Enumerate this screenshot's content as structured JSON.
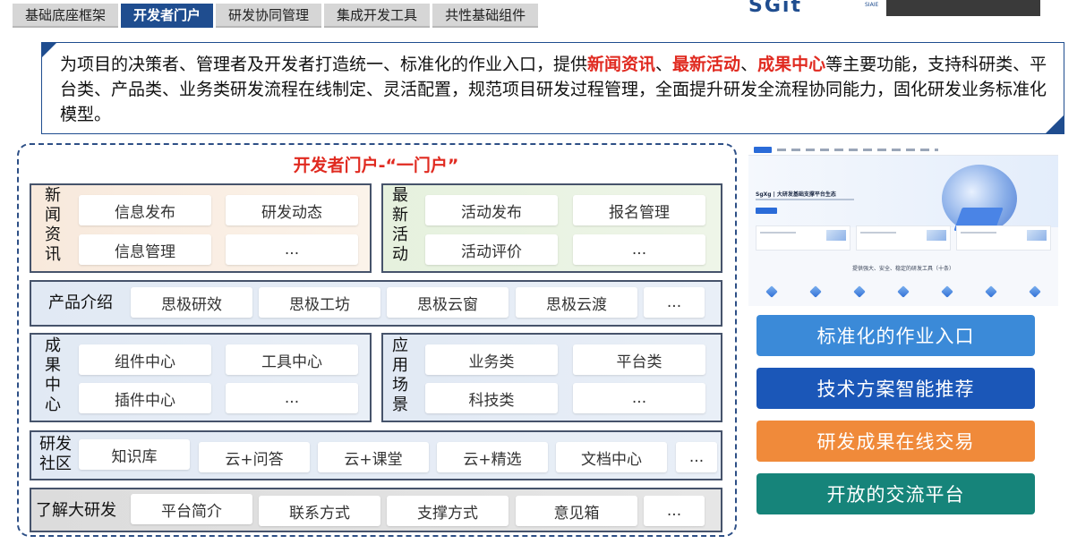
{
  "tabs": [
    "基础底座框架",
    "开发者门户",
    "研发协同管理",
    "集成开发工具",
    "共性基础组件"
  ],
  "active_tab": "开发者门户",
  "logo": {
    "text": "SGit",
    "sub": "SIAIE"
  },
  "intro": {
    "part1": "为项目的决策者、管理者及开发者打造统一、标准化的作业入口，提供",
    "hl1": "新闻资讯",
    "sep1": "、",
    "hl2": "最新活动",
    "sep2": "、",
    "hl3": "成果中心",
    "part2": "等主要功能，支持科研类、平台类、产品类、业务类研发流程在线制定、灵活配置，规范项目研发过程管理，全面提升研发全流程协同能力，固化研发业务标准化模型。"
  },
  "portal": {
    "title": "开发者门户-“一门户”",
    "news": {
      "label": "新闻资讯",
      "items": [
        "信息发布",
        "研发动态",
        "信息管理",
        "..."
      ]
    },
    "activities": {
      "label": "最新活动",
      "items": [
        "活动发布",
        "报名管理",
        "活动评价",
        "..."
      ]
    },
    "products": {
      "label": "产品介绍",
      "items": [
        "思极研效",
        "思极工坊",
        "思极云窗",
        "思极云渡",
        "..."
      ]
    },
    "results": {
      "label": "成果中心",
      "items": [
        "组件中心",
        "工具中心",
        "插件中心",
        "..."
      ]
    },
    "scenarios": {
      "label": "应用场景",
      "items": [
        "业务类",
        "平台类",
        "科技类",
        "..."
      ]
    },
    "community": {
      "label": "研发社区",
      "items": [
        "知识库",
        "云+问答",
        "云+课堂",
        "云+精选",
        "文档中心",
        "..."
      ]
    },
    "about": {
      "label": "了解大研发",
      "items": [
        "平台简介",
        "联系方式",
        "支撑方式",
        "意见箱",
        "..."
      ]
    }
  },
  "screenshot": {
    "hero_text": "SgXg | 大研发基础支撑平台生态",
    "caption": "提供强大、安全、稳定的研发工具（十条）"
  },
  "features": [
    {
      "label": "标准化的作业入口",
      "color": "#3b8ad8"
    },
    {
      "label": "技术方案智能推荐",
      "color": "#1b57b8"
    },
    {
      "label": "研发成果在线交易",
      "color": "#f08a3a"
    },
    {
      "label": "开放的交流平台",
      "color": "#16847a"
    }
  ]
}
